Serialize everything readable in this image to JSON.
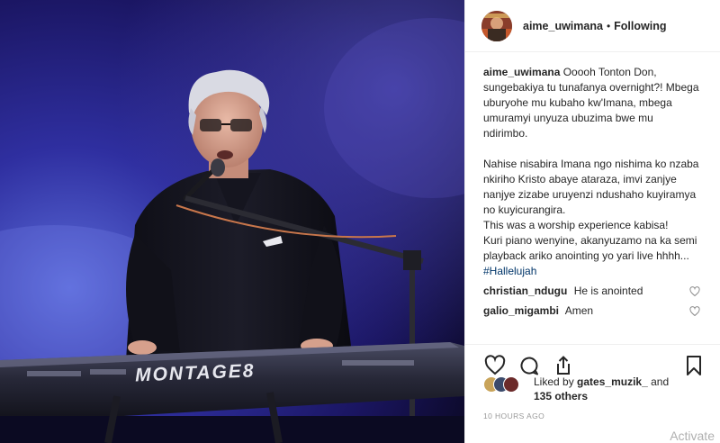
{
  "header": {
    "username": "aime_uwimana",
    "separator": "•",
    "follow_status": "Following"
  },
  "caption": {
    "username": "aime_uwimana",
    "text": "Ooooh Tonton Don, sungebakiya tu tunafanya overnight?! Mbega uburyohe mu kubaho kw'Imana, mbega umuramyi unyuza ubuzima bwe mu ndirimbo.\n\nNahise nisabira Imana ngo nishima ko nzaba nkiriho Kristo abaye ataraza, imvi zanjye nanjye zizabe uruyenzi ndushaho kuyiramya no kuyicurangira.\nThis was a worship experience kabisa!\nKuri piano wenyine, akanyuzamo na ka semi playback ariko anointing yo yari live hhhh...",
    "hashtag": "#Hallelujah"
  },
  "comments": [
    {
      "username": "christian_ndugu",
      "text": "He is anointed"
    },
    {
      "username": "galio_migambi",
      "text": "Amen"
    }
  ],
  "likes": {
    "prefix": "Liked by",
    "liker": "gates_muzik_",
    "conjunction": "and",
    "others": "135 others"
  },
  "timestamp": "10 HOURS AGO",
  "photo": {
    "keyboard_brand": "MONTAGE8"
  },
  "watermark": "Activate",
  "icons": {
    "like": "heart-icon",
    "comment": "comment-bubble-icon",
    "share": "share-icon",
    "save": "bookmark-icon"
  },
  "colors": {
    "text": "#262626",
    "muted": "#999999",
    "hashtag": "#003569",
    "stage_blue": "#2a2f9e",
    "border": "#efefef"
  }
}
